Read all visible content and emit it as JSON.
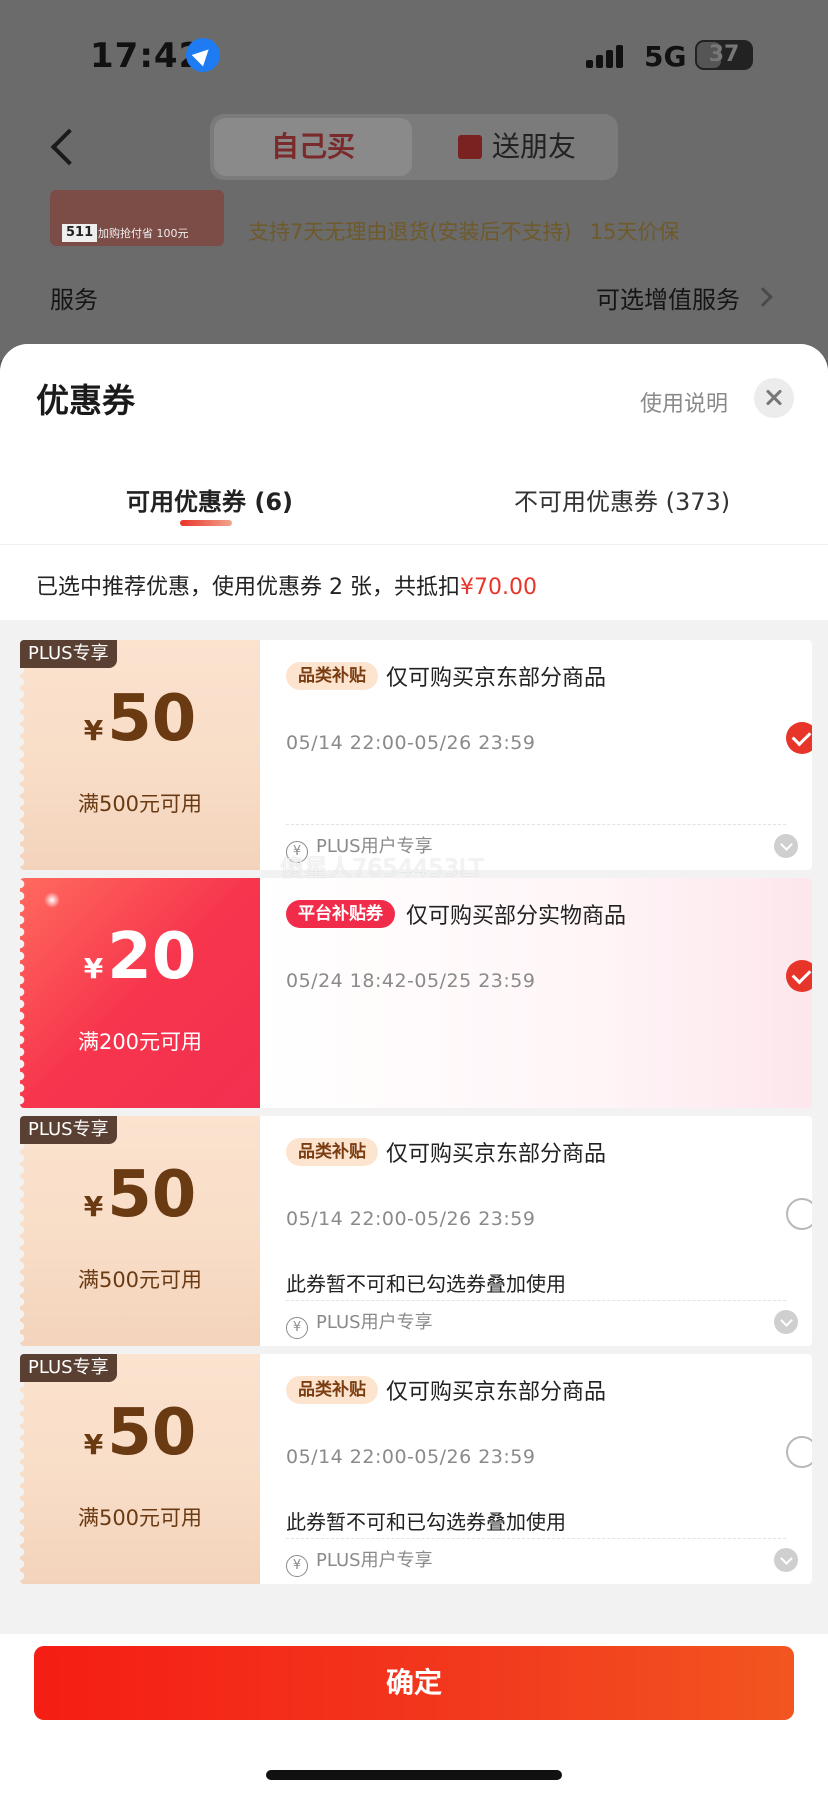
{
  "status_bar": {
    "time": "17:42",
    "network": "5G",
    "battery": "37"
  },
  "nav": {
    "tab_self": "自己买",
    "tab_gift": "送朋友"
  },
  "background": {
    "promo_tag": "511",
    "promo_caption": "加购抢付省",
    "promo_value": "100元",
    "promo_text": "支持7天无理由退货(安装后不支持)",
    "promo_guarantee": "15天价保",
    "service_label": "服务",
    "service_value": "可选增值服务"
  },
  "sheet": {
    "title": "优惠券",
    "usage_link": "使用说明",
    "tab_available": "可用优惠券 (6)",
    "tab_unavailable": "不可用优惠券 (373)",
    "summary_prefix": "已选中推荐优惠，使用优惠券 2 张，共抵扣",
    "summary_amount": "¥70.00"
  },
  "coupons": [
    {
      "badge": "PLUS专享",
      "yen": "¥",
      "amount": "50",
      "threshold": "满500元可用",
      "tag": "品类补贴",
      "desc": "仅可购买京东部分商品",
      "validity": "05/14 22:00-05/26 23:59",
      "note": "",
      "plus_line": "PLUS用户专享",
      "selected": true
    },
    {
      "badge": "",
      "yen": "¥",
      "amount": "20",
      "threshold": "满200元可用",
      "tag": "平台补贴券",
      "desc": "仅可购买部分实物商品",
      "validity": "05/24 18:42-05/25 23:59",
      "note": "",
      "plus_line": "",
      "selected": true
    },
    {
      "badge": "PLUS专享",
      "yen": "¥",
      "amount": "50",
      "threshold": "满500元可用",
      "tag": "品类补贴",
      "desc": "仅可购买京东部分商品",
      "validity": "05/14 22:00-05/26 23:59",
      "note": "此券暂不可和已勾选券叠加使用",
      "plus_line": "PLUS用户专享",
      "selected": false
    },
    {
      "badge": "PLUS专享",
      "yen": "¥",
      "amount": "50",
      "threshold": "满500元可用",
      "tag": "品类补贴",
      "desc": "仅可购买京东部分商品",
      "validity": "05/14 22:00-05/26 23:59",
      "note": "此券暂不可和已勾选券叠加使用",
      "plus_line": "PLUS用户专享",
      "selected": false
    }
  ],
  "watermark": "傻星人7654453LT",
  "confirm_label": "确定",
  "colors": {
    "accent": "#e8352a",
    "coupon_brown": "#6a3a12",
    "coupon_red": "#f23050"
  }
}
